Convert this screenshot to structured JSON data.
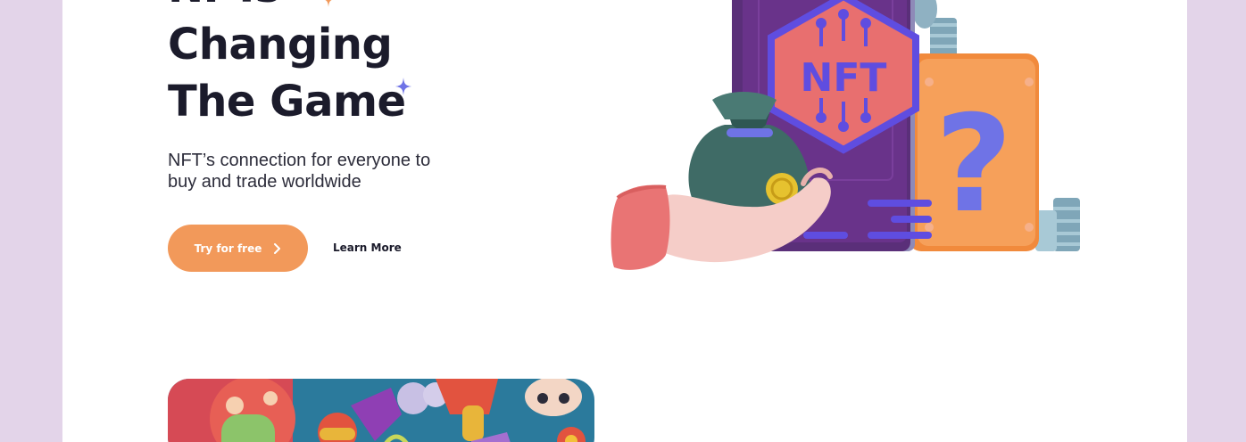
{
  "hero": {
    "title_lines": [
      "NFTs",
      "Changing",
      "The Game"
    ],
    "subtitle": "NFT’s connection for everyone to buy and trade worldwide"
  },
  "actions": {
    "primary_label": "Try for free",
    "secondary_label": "Learn More"
  },
  "illustration": {
    "book_label": "NFT",
    "box_symbol": "?"
  },
  "colors": {
    "background": "#e3d4e9",
    "page": "#ffffff",
    "accent_orange": "#f2995a",
    "heading": "#1b1b2b",
    "sparkle_blue": "#6f73e6"
  },
  "icons": [
    "sparkle-orange-icon",
    "sparkle-blue-icon",
    "chevron-right-icon"
  ]
}
